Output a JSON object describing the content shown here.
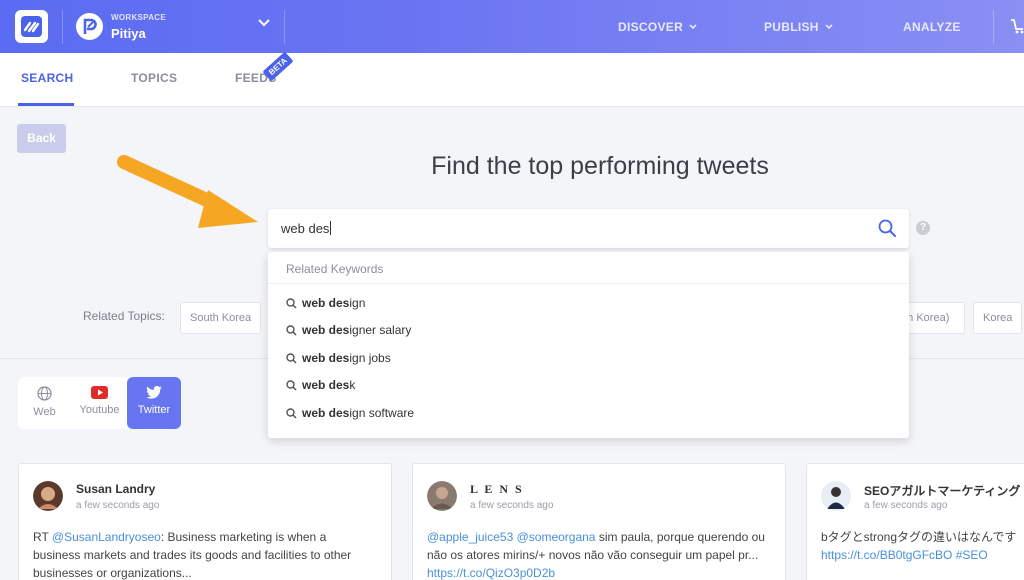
{
  "colors": {
    "accent": "#4a63e8",
    "topbar_start": "#5a6cf2",
    "twitter_active": "#6776f0",
    "arrow": "#f5a623"
  },
  "workspace": {
    "label": "WORKSPACE",
    "name": "Pitiya"
  },
  "nav": [
    {
      "label": "DISCOVER",
      "has_dropdown": true
    },
    {
      "label": "PUBLISH",
      "has_dropdown": true
    },
    {
      "label": "ANALYZE",
      "has_dropdown": false
    }
  ],
  "tabs": [
    {
      "label": "SEARCH",
      "active": true
    },
    {
      "label": "TOPICS",
      "active": false
    },
    {
      "label": "FEEDS",
      "active": false,
      "badge": "BETA"
    }
  ],
  "back_label": "Back",
  "heading": "Find the top performing tweets",
  "search": {
    "value": "web des",
    "typed_prefix": "web des"
  },
  "suggestions": {
    "header": "Related Keywords",
    "items": [
      {
        "bold": "web des",
        "rest": "ign"
      },
      {
        "bold": "web des",
        "rest": "igner salary"
      },
      {
        "bold": "web des",
        "rest": "ign jobs"
      },
      {
        "bold": "web des",
        "rest": "k"
      },
      {
        "bold": "web des",
        "rest": "ign software"
      }
    ]
  },
  "related_topics": {
    "label": "Related Topics:",
    "chips": [
      "South Korea",
      "uth Korea)",
      "Korea"
    ]
  },
  "sources": [
    {
      "label": "Web",
      "icon": "globe-icon",
      "active": false
    },
    {
      "label": "Youtube",
      "icon": "youtube-icon",
      "active": false
    },
    {
      "label": "Twitter",
      "icon": "twitter-icon",
      "active": true
    }
  ],
  "tweets": [
    {
      "name": "Susan Landry",
      "time": "a few seconds ago",
      "lines": [
        [
          {
            "t": "RT "
          },
          {
            "t": "@SusanLandryoseo",
            "link": true
          },
          {
            "t": ": Business marketing is when a"
          }
        ],
        [
          {
            "t": "business markets and trades its goods and facilities to other"
          }
        ],
        [
          {
            "t": "businesses or organizations..."
          }
        ]
      ]
    },
    {
      "name": "L E N S",
      "time": "a few seconds ago",
      "lines": [
        [
          {
            "t": "@apple_juice53",
            "link": true
          },
          {
            "t": " "
          },
          {
            "t": "@someorgana",
            "link": true
          },
          {
            "t": " sim paula, porque querendo ou"
          }
        ],
        [
          {
            "t": "não os atores mirins/+ novos não vão conseguir um papel pr..."
          }
        ],
        [
          {
            "t": "https://t.co/QizO3p0D2b",
            "link": true
          }
        ]
      ]
    },
    {
      "name": "SEOアガルトマーケティング",
      "time": "a few seconds ago",
      "lines": [
        [
          {
            "t": "bタグとstrongタグの違いはなんです"
          }
        ],
        [
          {
            "t": "https://t.co/BB0tgGFcBO",
            "link": true
          },
          {
            "t": " "
          },
          {
            "t": "#SEO",
            "link": true
          }
        ]
      ]
    }
  ]
}
